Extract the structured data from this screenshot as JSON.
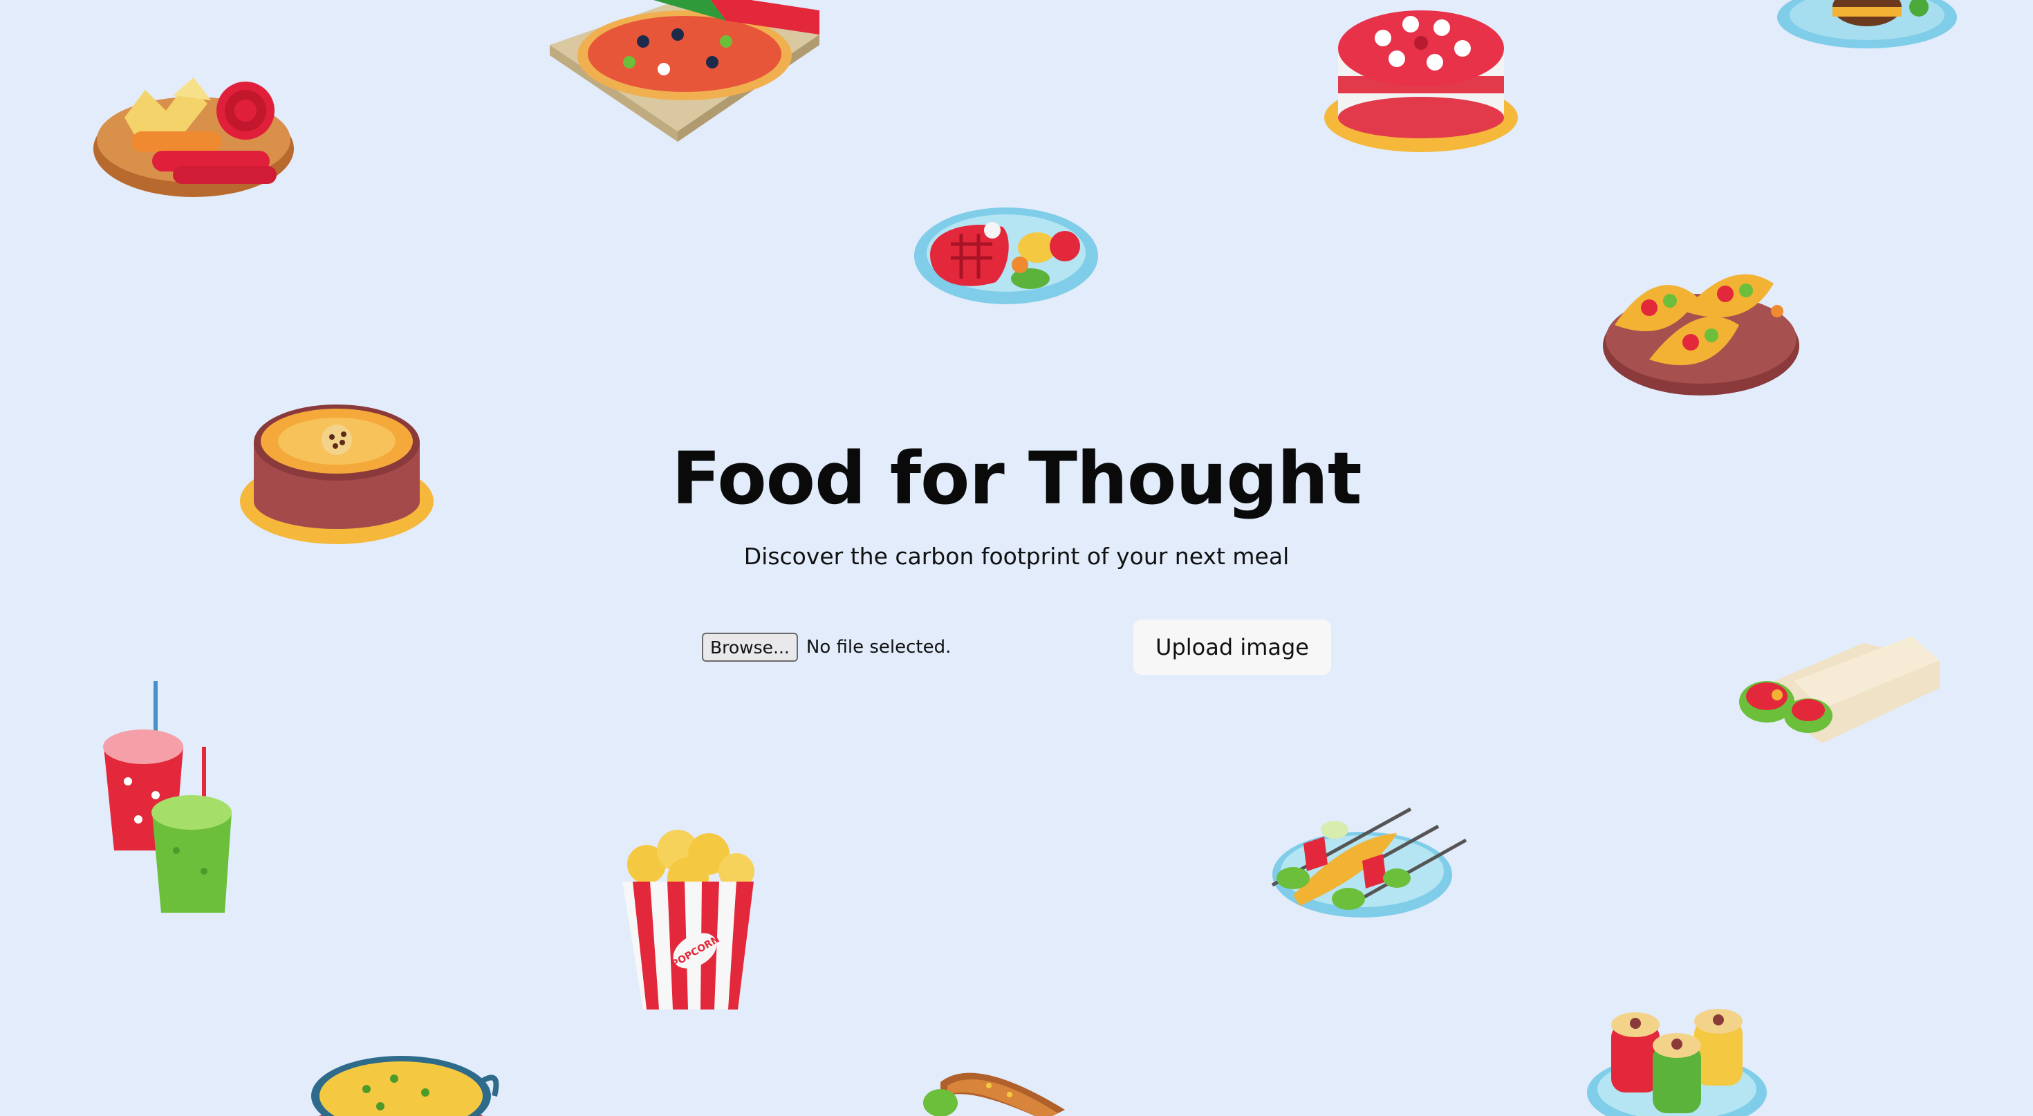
{
  "hero": {
    "title": "Food for Thought",
    "subtitle": "Discover the carbon footprint of your next meal"
  },
  "upload_form": {
    "browse_label": "Browse...",
    "file_status": "No file selected.",
    "upload_label": "Upload image"
  },
  "decorations": {
    "popcorn_box_text": "POPCORN",
    "icons": [
      "sausage-platter-icon",
      "pizza-box-icon",
      "strawberry-cake-icon",
      "burger-plate-icon",
      "steak-plate-icon",
      "tacos-board-icon",
      "fruit-tart-icon",
      "burrito-wraps-icon",
      "smoothie-cups-icon",
      "popcorn-icon",
      "grilled-skewers-icon",
      "soup-pot-icon",
      "hot-dog-icon",
      "stuffed-peppers-icon"
    ]
  },
  "colors": {
    "background": "#e2ecfb",
    "button_background": "#f7f7f7",
    "text": "#0a0a0a"
  }
}
